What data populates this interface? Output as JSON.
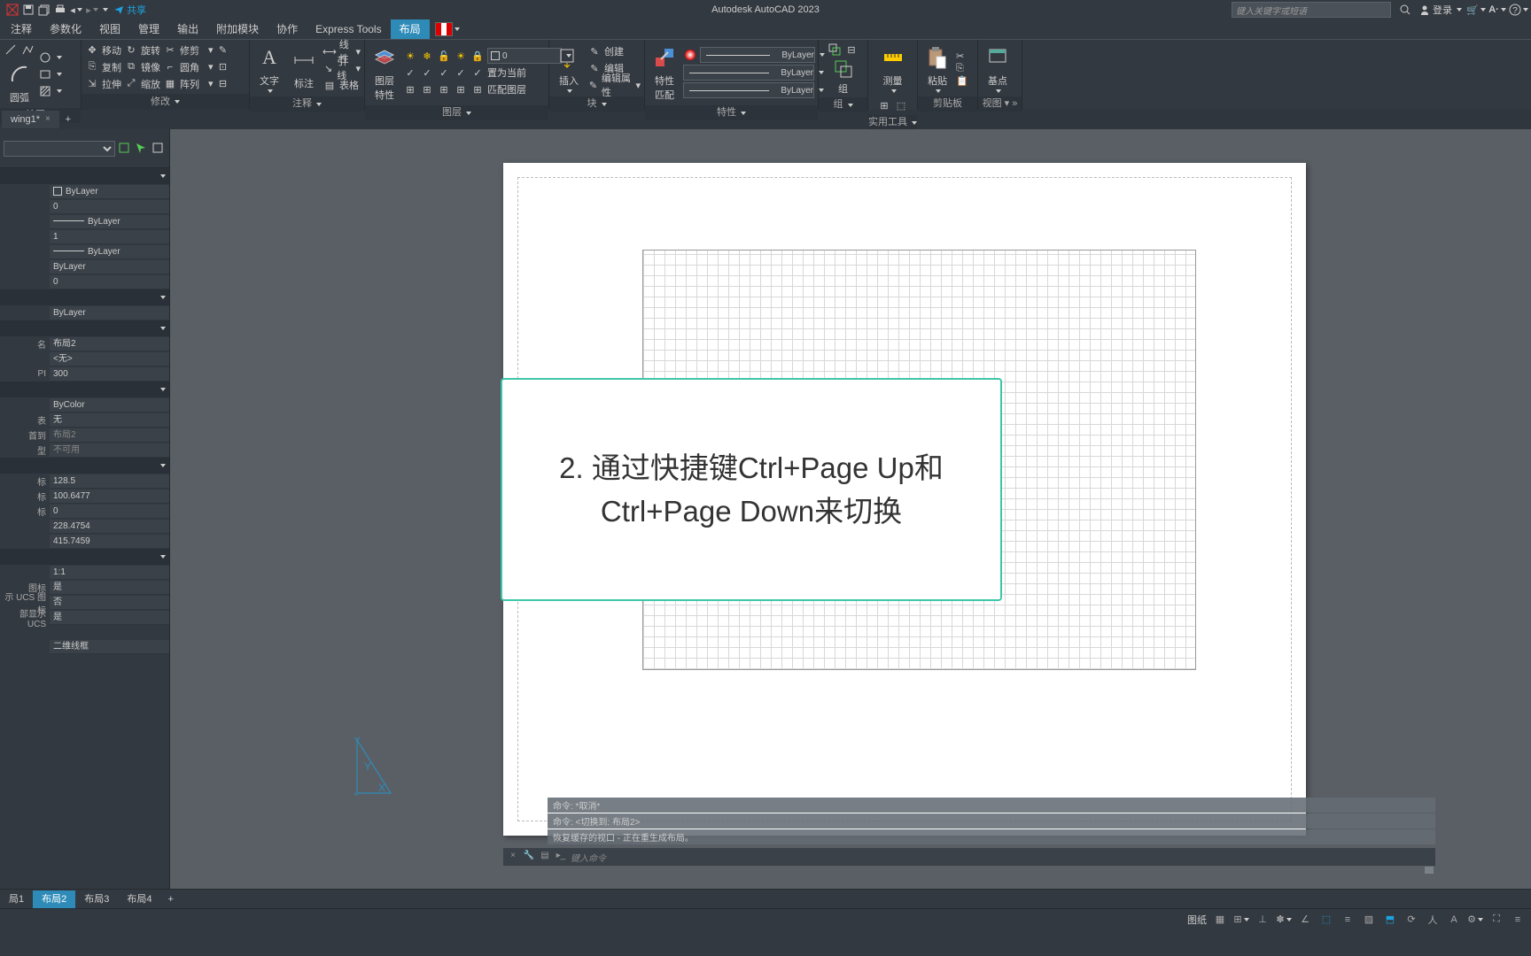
{
  "app_title": "Autodesk AutoCAD 2023",
  "qat": {
    "share": "共享",
    "search_placeholder": "键入关键字或短语",
    "login": "登录"
  },
  "tabs": [
    "注释",
    "参数化",
    "视图",
    "管理",
    "输出",
    "附加模块",
    "协作",
    "Express Tools",
    "布局"
  ],
  "active_tab": "布局",
  "ribbon": {
    "panels": [
      {
        "label": "绘图",
        "expand": "▾"
      },
      {
        "label": "修改",
        "expand": "▾"
      },
      {
        "label": "注释",
        "expand": "▾"
      },
      {
        "label": "图层",
        "expand": "▾"
      },
      {
        "label": "块",
        "expand": "▾"
      },
      {
        "label": "特性",
        "expand": "▾"
      },
      {
        "label": "组",
        "expand": "▾"
      },
      {
        "label": "实用工具",
        "expand": "▾"
      },
      {
        "label": "剪贴板",
        "expand": ""
      },
      {
        "label": "视图",
        "expand": "▾ »"
      }
    ],
    "draw_big": "圆弧",
    "modify": {
      "r1a": "移动",
      "r1b": "旋转",
      "r1c": "修剪",
      "r2a": "复制",
      "r2b": "镜像",
      "r2c": "圆角",
      "r3a": "拉伸",
      "r3b": "缩放",
      "r3c": "阵列"
    },
    "annot": {
      "big1": "文字",
      "big2": "标注",
      "r1": "线性",
      "r2": "引线",
      "r3": "表格"
    },
    "layer": {
      "big": "图层\n特性",
      "r1": "置为当前",
      "r2": "匹配图层",
      "current": "0"
    },
    "block": {
      "big": "插入",
      "r1": "创建",
      "r2": "编辑",
      "r3": "编辑属性"
    },
    "props": {
      "big": "特性\n匹配",
      "bylayer": "ByLayer"
    },
    "group": "组",
    "util": "测量",
    "clip": "粘贴",
    "view": "基点"
  },
  "file_tab": "wing1*",
  "properties": {
    "header_icons": 3,
    "sec1": [
      {
        "k": "",
        "v": "ByLayer",
        "swatch": true
      },
      {
        "k": "",
        "v": "0"
      },
      {
        "k": "",
        "v": "ByLayer",
        "line": true
      },
      {
        "k": "",
        "v": "1"
      },
      {
        "k": "",
        "v": "ByLayer",
        "line": true
      },
      {
        "k": "",
        "v": "ByLayer"
      },
      {
        "k": "",
        "v": "0"
      }
    ],
    "sec2": [
      {
        "k": "",
        "v": "ByLayer"
      }
    ],
    "sec3": [
      {
        "k": "名",
        "v": "布局2"
      },
      {
        "k": "",
        "v": "<无>"
      },
      {
        "k": "PI",
        "v": "300"
      }
    ],
    "sec4": [
      {
        "k": "",
        "v": "ByColor"
      },
      {
        "k": "表",
        "v": "无"
      },
      {
        "k": "首到",
        "v": "布局2",
        "rd": true
      },
      {
        "k": "型",
        "v": "不可用",
        "rd": true
      }
    ],
    "sec5": [
      {
        "k": "标",
        "v": "128.5"
      },
      {
        "k": "标",
        "v": "100.6477"
      },
      {
        "k": "标",
        "v": "0"
      },
      {
        "k": "",
        "v": "228.4754"
      },
      {
        "k": "",
        "v": "415.7459"
      }
    ],
    "sec6": [
      {
        "k": "",
        "v": "1:1"
      },
      {
        "k": "图标",
        "v": "是"
      },
      {
        "k": "示 UCS 图标",
        "v": "否"
      },
      {
        "k": "部显示 UCS",
        "v": "是"
      }
    ],
    "sec7": [
      {
        "k": "",
        "v": "二维线框"
      }
    ]
  },
  "callout": "2. 通过快捷键Ctrl+Page Up和Ctrl+Page Down来切换",
  "cmdlog": [
    "命令: *取消*",
    "命令:   <切换到: 布局2>",
    "恢复缓存的视口 - 正在重生成布局。"
  ],
  "cmd_prompt": "键入命令",
  "model_tabs": [
    "局1",
    "布局2",
    "布局3",
    "布局4"
  ],
  "active_model": "布局2",
  "status": {
    "paper": "图纸"
  }
}
